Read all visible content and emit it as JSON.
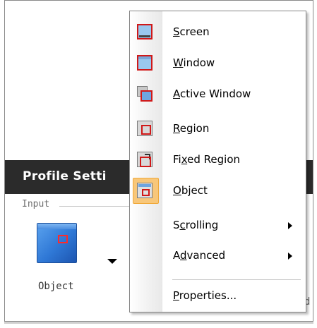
{
  "background": {
    "header_title": "Profile Setti",
    "input_section_label": "Input",
    "object_button_label": "Object",
    "clipped_text": "d"
  },
  "menu": {
    "items": [
      {
        "pre": "",
        "mnemonic": "S",
        "post": "creen",
        "icon": "screen-capture-icon",
        "submenu": false,
        "highlighted": false
      },
      {
        "pre": "",
        "mnemonic": "W",
        "post": "indow",
        "icon": "window-capture-icon",
        "submenu": false,
        "highlighted": false
      },
      {
        "pre": "",
        "mnemonic": "A",
        "post": "ctive Window",
        "icon": "active-window-capture-icon",
        "submenu": false,
        "highlighted": false
      },
      {
        "pre": "",
        "mnemonic": "R",
        "post": "egion",
        "icon": "region-capture-icon",
        "submenu": false,
        "highlighted": false
      },
      {
        "pre": "Fi",
        "mnemonic": "x",
        "post": "ed Region",
        "icon": "fixed-region-capture-icon",
        "submenu": false,
        "highlighted": false
      },
      {
        "pre": "",
        "mnemonic": "O",
        "post": "bject",
        "icon": "object-capture-icon",
        "submenu": false,
        "highlighted": true
      },
      {
        "pre": "S",
        "mnemonic": "c",
        "post": "rolling",
        "icon": "",
        "submenu": true,
        "highlighted": false
      },
      {
        "pre": "A",
        "mnemonic": "d",
        "post": "vanced",
        "icon": "",
        "submenu": true,
        "highlighted": false
      },
      {
        "pre": "",
        "mnemonic": "P",
        "post": "roperties...",
        "icon": "",
        "submenu": false,
        "highlighted": false
      }
    ]
  },
  "colors": {
    "header_bg": "#2b2b2b",
    "highlight": "#f8c77a",
    "capture_red": "#d01818"
  }
}
